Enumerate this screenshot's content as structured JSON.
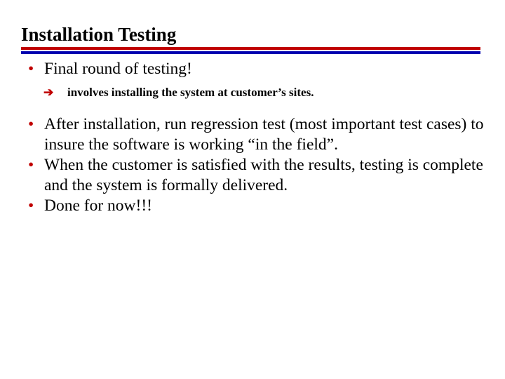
{
  "slide": {
    "title": "Installation Testing",
    "divider": {
      "top_rule_color": "#C00000",
      "bottom_rule_color": "#0000B0"
    },
    "bullet_marker": "•",
    "sub_bullet_marker": "➔",
    "bullet_color": "#C00000",
    "text_color": "#000000",
    "background_color": "#FFFFFF",
    "bullets": [
      {
        "level": 1,
        "marker": "•",
        "text": "Final round of testing!"
      },
      {
        "level": 2,
        "marker": "➔",
        "text": "involves installing the system at customer’s sites."
      },
      {
        "level": 1,
        "marker": "•",
        "text": "After installation, run regression test (most important test cases) to insure the software is working “in the field”."
      },
      {
        "level": 1,
        "marker": "•",
        "text": "When the customer is satisfied with the results, testing is complete and the system is formally delivered."
      },
      {
        "level": 1,
        "marker": "•",
        "text": "Done for now!!!"
      }
    ]
  }
}
